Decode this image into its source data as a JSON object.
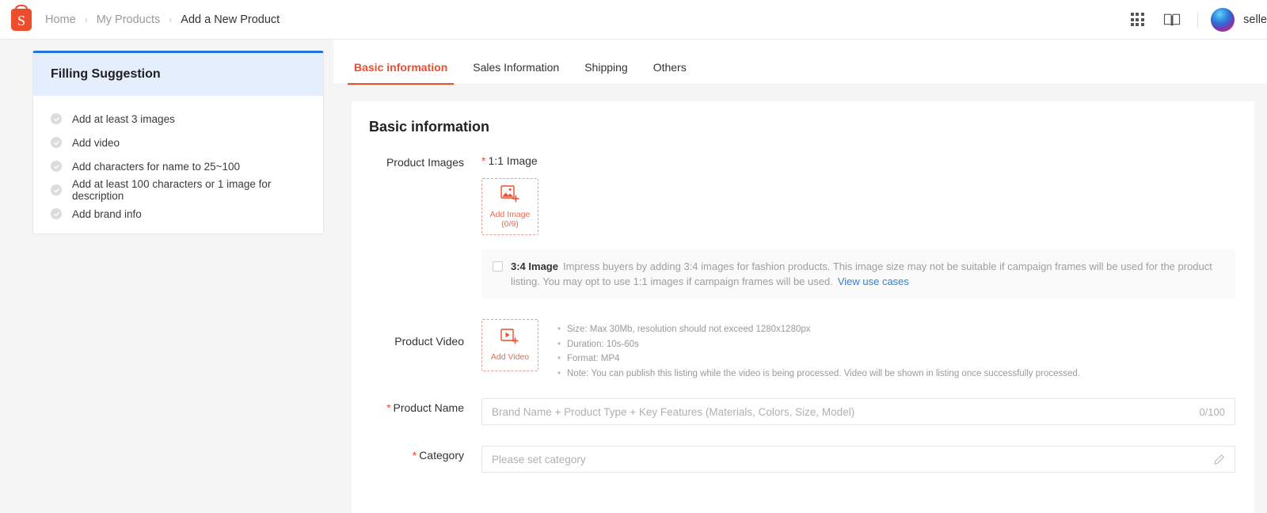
{
  "topbar": {
    "logo_alt": "shopee-logo",
    "logo_letter": "S",
    "breadcrumb": [
      {
        "label": "Home",
        "current": false
      },
      {
        "label": "My Products",
        "current": false
      },
      {
        "label": "Add a New Product",
        "current": true
      }
    ],
    "separator": "›",
    "icons": [
      {
        "name": "apps-grid-icon"
      },
      {
        "name": "book-icon"
      }
    ],
    "seller_name": "selle"
  },
  "suggestion_panel": {
    "title": "Filling Suggestion",
    "accent_color": "#2673dd",
    "header_bg": "#e4eefc",
    "items": [
      {
        "label": "Add at least 3 images",
        "done": false
      },
      {
        "label": "Add video",
        "done": false
      },
      {
        "label": "Add characters for name to 25~100",
        "done": false
      },
      {
        "label": "Add at least 100 characters or 1 image for description",
        "done": false
      },
      {
        "label": "Add brand info",
        "done": false
      }
    ]
  },
  "tabs": [
    {
      "label": "Basic information",
      "active": true
    },
    {
      "label": "Sales Information",
      "active": false
    },
    {
      "label": "Shipping",
      "active": false
    },
    {
      "label": "Others",
      "active": false
    }
  ],
  "accent_color": "#ee4d2d",
  "form": {
    "section_title": "Basic information",
    "product_images": {
      "label": "Product Images",
      "ratio_label": "1:1 Image",
      "required": true,
      "upload_caption_line1": "Add Image",
      "upload_caption_line2": "(0/9)",
      "ratio34": {
        "checked": false,
        "title": "3:4 Image",
        "description": "Impress buyers by adding 3:4 images for fashion products. This image size may not be suitable if campaign frames will be used for the product listing. You may opt to use 1:1 images if campaign frames will be used.",
        "link": "View use cases"
      }
    },
    "product_video": {
      "label": "Product Video",
      "required": false,
      "upload_caption": "Add Video",
      "specs": [
        "Size: Max 30Mb, resolution should not exceed 1280x1280px",
        "Duration: 10s-60s",
        "Format: MP4",
        "Note: You can publish this listing while the video is being processed. Video will be shown in listing once successfully processed."
      ]
    },
    "product_name": {
      "label": "Product Name",
      "required": true,
      "value": "",
      "placeholder": "Brand Name + Product Type + Key Features (Materials, Colors, Size, Model)",
      "counter": "0/100"
    },
    "category": {
      "label": "Category",
      "required": true,
      "value": "",
      "placeholder": "Please set category",
      "edit_icon": "pencil-icon"
    }
  }
}
